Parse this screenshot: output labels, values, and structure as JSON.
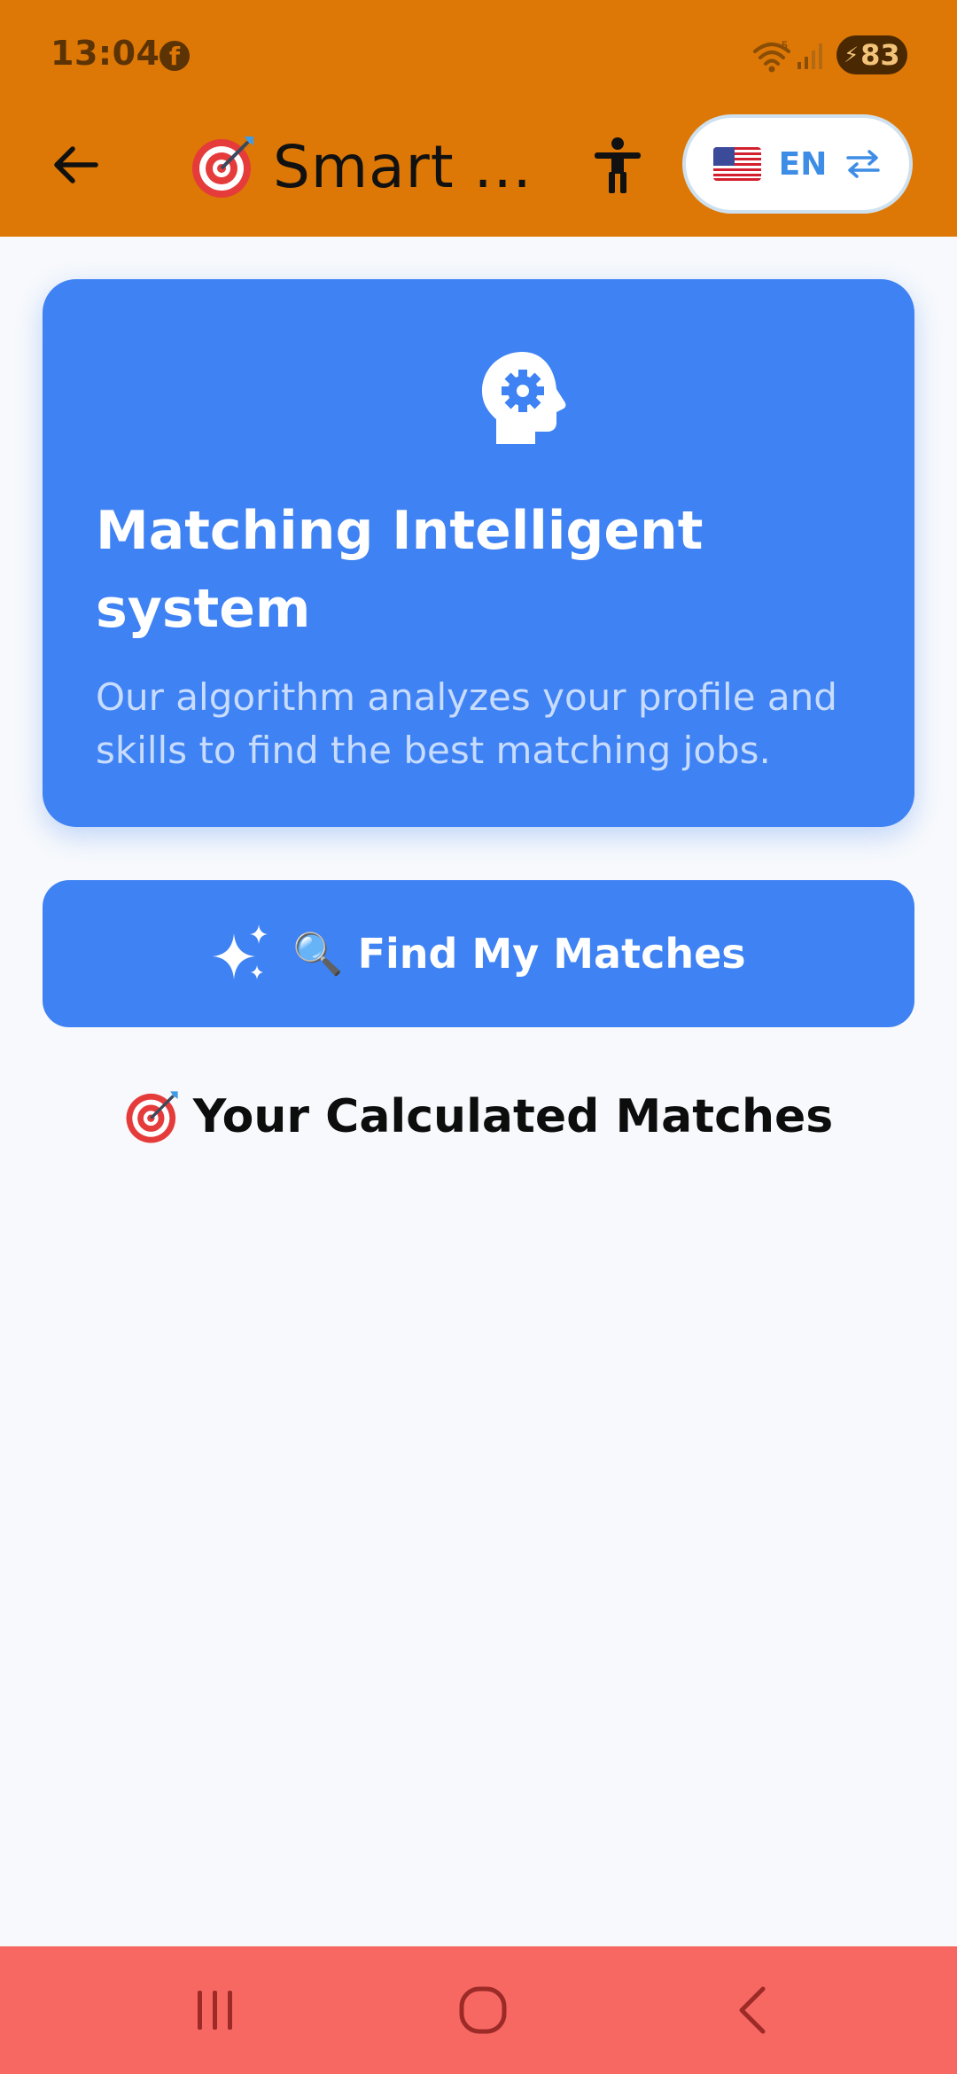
{
  "status_bar": {
    "time": "13:04",
    "notification_icon": "facebook-icon",
    "wifi_badge": "5",
    "battery_level": "83"
  },
  "app_bar": {
    "title": "Smart ...",
    "title_emoji": "target-icon",
    "language": {
      "code": "EN",
      "flag": "us-flag-icon"
    }
  },
  "intro_card": {
    "icon": "brain-gear-icon",
    "title": "Matching Intelligent system",
    "description": "Our algorithm analyzes your profile and skills to find the best matching jobs."
  },
  "find_button": {
    "label": "🔍 Find My Matches"
  },
  "matches": {
    "heading": "Your Calculated Matches"
  },
  "colors": {
    "header_bg": "#dd7806",
    "accent_blue": "#3f82f3",
    "nav_bg": "#f76863",
    "page_bg": "#f7f9fc"
  }
}
